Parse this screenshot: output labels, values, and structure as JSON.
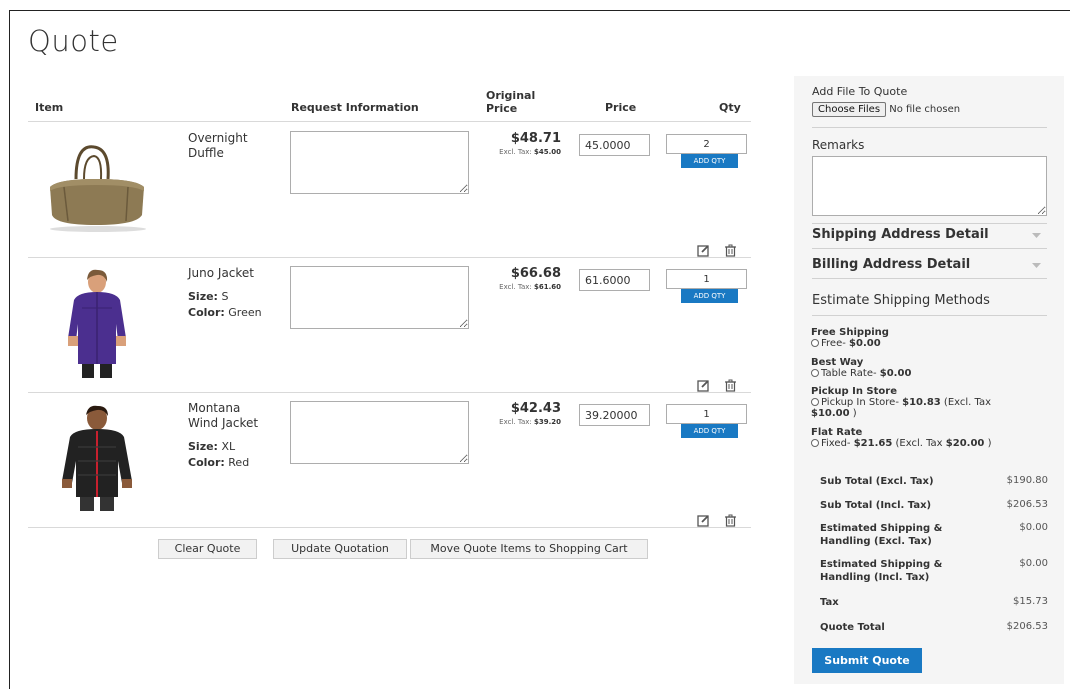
{
  "page": {
    "title": "Quote"
  },
  "table": {
    "headers": {
      "item": "Item",
      "request": "Request Information",
      "original_price": "Original Price",
      "price": "Price",
      "qty": "Qty"
    },
    "rows": [
      {
        "name": "Overnight Duffle",
        "options": [],
        "original_price": "$48.71",
        "excl_tax_label": "Excl. Tax:",
        "excl_tax_value": "$45.00",
        "price": "45.0000",
        "qty": "2",
        "add_qty_label": "ADD QTY"
      },
      {
        "name": "Juno Jacket",
        "options": [
          {
            "label": "Size:",
            "value": "S"
          },
          {
            "label": "Color:",
            "value": "Green"
          }
        ],
        "original_price": "$66.68",
        "excl_tax_label": "Excl. Tax:",
        "excl_tax_value": "$61.60",
        "price": "61.6000",
        "qty": "1",
        "add_qty_label": "ADD QTY"
      },
      {
        "name": "Montana Wind Jacket",
        "options": [
          {
            "label": "Size:",
            "value": "XL"
          },
          {
            "label": "Color:",
            "value": "Red"
          }
        ],
        "original_price": "$42.43",
        "excl_tax_label": "Excl. Tax:",
        "excl_tax_value": "$39.20",
        "price": "39.20000",
        "qty": "1",
        "add_qty_label": "ADD QTY"
      }
    ]
  },
  "buttons": {
    "clear": "Clear Quote",
    "update": "Update Quotation",
    "move": "Move Quote Items to Shopping Cart"
  },
  "sidebar": {
    "add_file_title": "Add File To Quote",
    "choose_files": "Choose Files",
    "no_file": "No file chosen",
    "remarks_title": "Remarks",
    "shipping_address": "Shipping Address Detail",
    "billing_address": "Billing Address Detail",
    "estimate_title": "Estimate Shipping Methods",
    "shipping_methods": [
      {
        "carrier": "Free Shipping",
        "method": "Free-",
        "price": "$0.00",
        "excl_prefix": "",
        "excl_price": "",
        "excl_suffix": ""
      },
      {
        "carrier": "Best Way",
        "method": "Table Rate-",
        "price": "$0.00",
        "excl_prefix": "",
        "excl_price": "",
        "excl_suffix": ""
      },
      {
        "carrier": "Pickup In Store",
        "method": "Pickup In Store-",
        "price": "$10.83",
        "excl_prefix": "(Excl. Tax",
        "excl_price": "$10.00",
        "excl_suffix": ")"
      },
      {
        "carrier": "Flat Rate",
        "method": "Fixed-",
        "price": "$21.65",
        "excl_prefix": "(Excl. Tax",
        "excl_price": "$20.00",
        "excl_suffix": ")"
      }
    ],
    "totals": [
      {
        "label": "Sub Total (Excl. Tax)",
        "value": "$190.80"
      },
      {
        "label": "Sub Total (Incl. Tax)",
        "value": "$206.53"
      },
      {
        "label": "Estimated Shipping & Handling (Excl. Tax)",
        "value": "$0.00"
      },
      {
        "label": "Estimated Shipping & Handling (Incl. Tax)",
        "value": "$0.00"
      },
      {
        "label": "Tax",
        "value": "$15.73"
      },
      {
        "label": "Quote Total",
        "value": "$206.53"
      }
    ],
    "submit": "Submit Quote"
  },
  "colors": {
    "accent": "#1979c3",
    "sidebar_bg": "#f5f5f5",
    "border": "#d9d9d9"
  },
  "icons": [
    "edit-icon",
    "trash-icon",
    "chevron-down-icon",
    "radio-icon"
  ]
}
